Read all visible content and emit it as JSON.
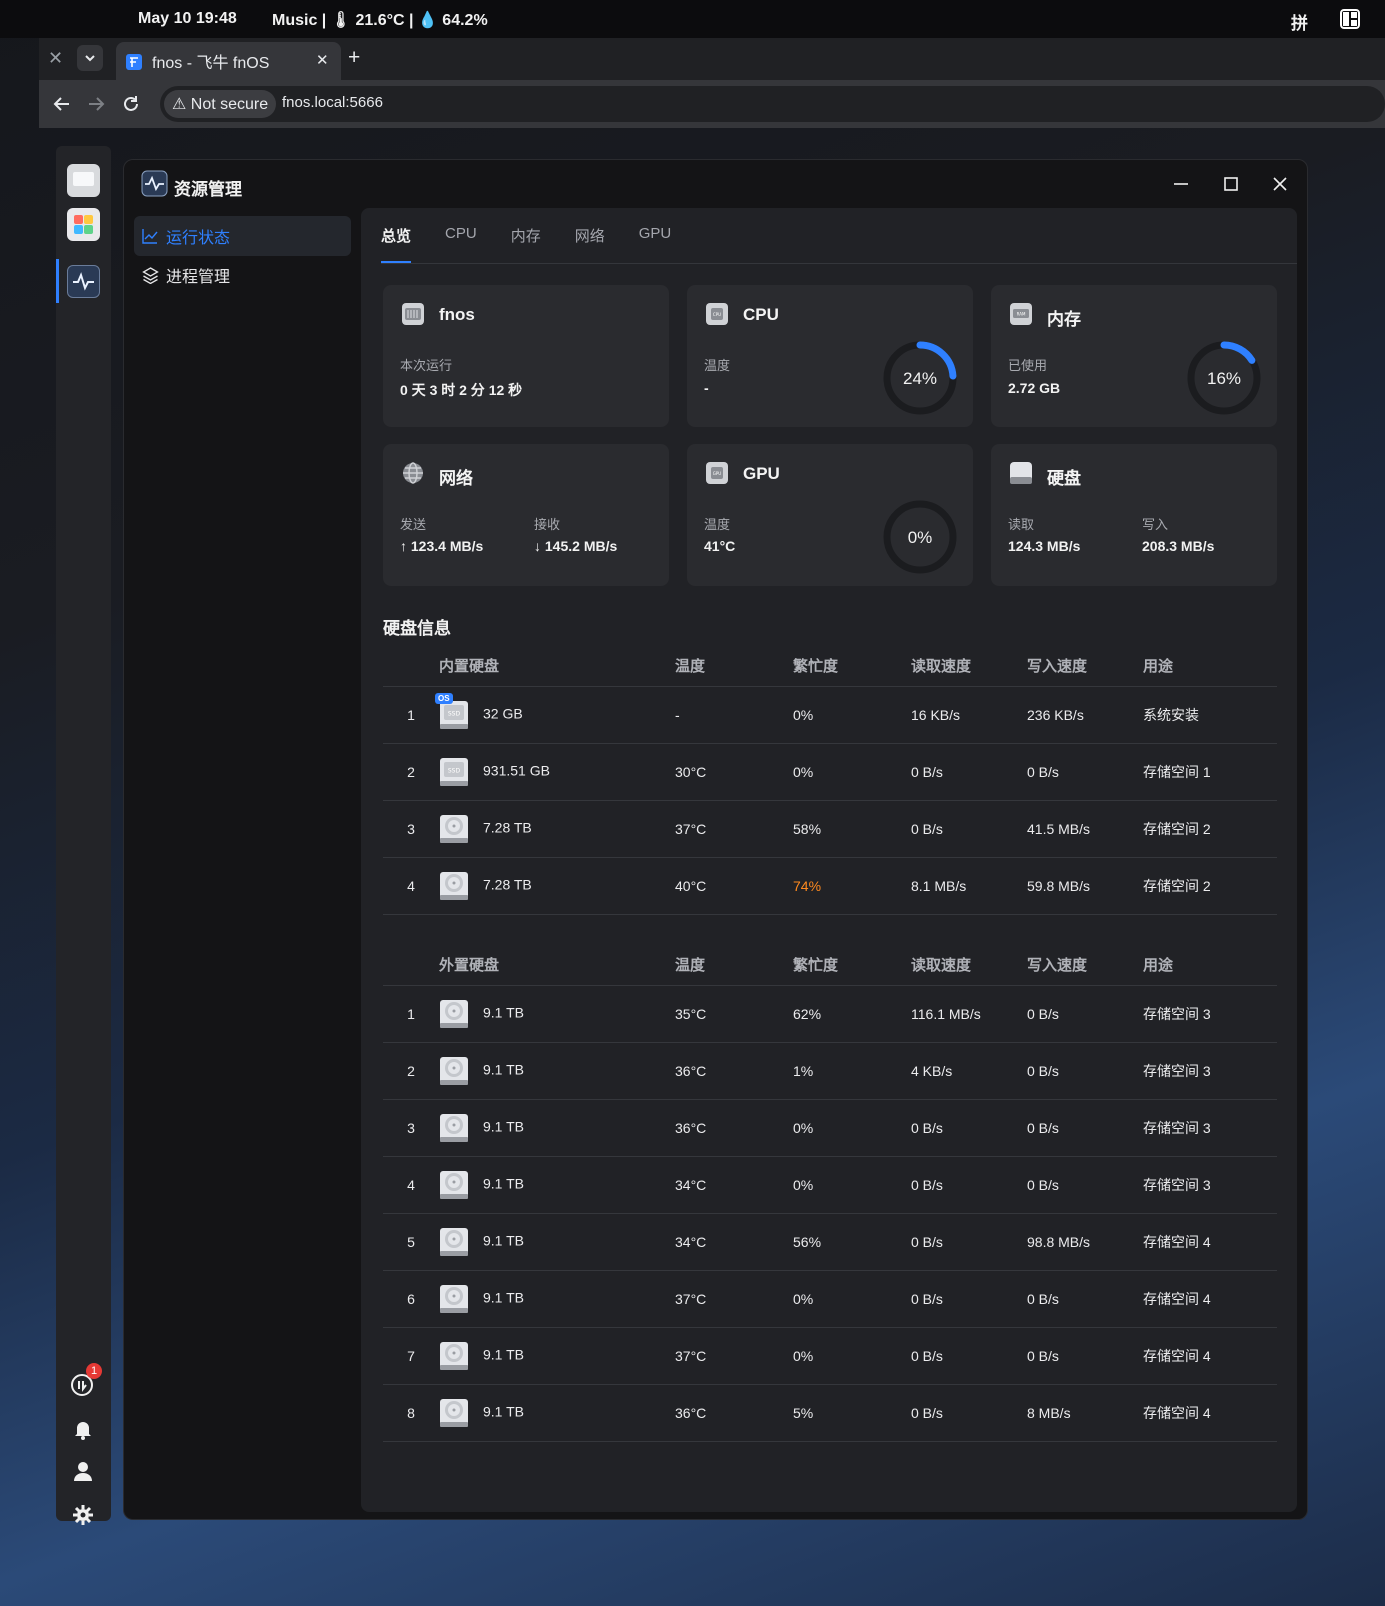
{
  "system_bar": {
    "datetime": "May 10  19:48",
    "music_status": "Music | 🌡 21.6°C | 💧 64.2%",
    "ime": "拼"
  },
  "browser": {
    "tab_title": "fnos - 飞牛 fnOS",
    "new_tab": "+",
    "security_label": "⚠ Not secure",
    "url": "fnos.local:5666"
  },
  "app": {
    "title": "资源管理",
    "sidebar": [
      {
        "label": "运行状态",
        "active": true
      },
      {
        "label": "进程管理",
        "active": false
      }
    ],
    "tabs": [
      "总览",
      "CPU",
      "内存",
      "网络",
      "GPU"
    ],
    "cards": {
      "system": {
        "title": "fnos",
        "uptime_label": "本次运行",
        "uptime_value": "0 天 3 时 2 分 12 秒"
      },
      "cpu": {
        "title": "CPU",
        "temp_label": "温度",
        "temp_value": "-",
        "usage_text": "24%",
        "usage": 0.24
      },
      "memory": {
        "title": "内存",
        "used_label": "已使用",
        "used_value": "2.72 GB",
        "usage_text": "16%",
        "usage": 0.16
      },
      "network": {
        "title": "网络",
        "send_label": "发送",
        "send_value": "↑ 123.4 MB/s",
        "recv_label": "接收",
        "recv_value": "↓ 145.2 MB/s"
      },
      "gpu": {
        "title": "GPU",
        "temp_label": "温度",
        "temp_value": "41°C",
        "usage_text": "0%",
        "usage": 0
      },
      "disk": {
        "title": "硬盘",
        "read_label": "读取",
        "read_value": "124.3 MB/s",
        "write_label": "写入",
        "write_value": "208.3 MB/s"
      }
    },
    "disk_section_title": "硬盘信息",
    "internal_headers": [
      "",
      "内置硬盘",
      "温度",
      "繁忙度",
      "读取速度",
      "写入速度",
      "用途"
    ],
    "external_headers": [
      "",
      "外置硬盘",
      "温度",
      "繁忙度",
      "读取速度",
      "写入速度",
      "用途"
    ],
    "internal_disks": [
      {
        "no": "1",
        "type": "ssd-os",
        "size": "32 GB",
        "temp": "-",
        "busy": "0%",
        "read": "16 KB/s",
        "write": "236 KB/s",
        "use": "系统安装"
      },
      {
        "no": "2",
        "type": "ssd",
        "size": "931.51 GB",
        "temp": "30°C",
        "busy": "0%",
        "read": "0 B/s",
        "write": "0 B/s",
        "use": "存储空间 1"
      },
      {
        "no": "3",
        "type": "hdd",
        "size": "7.28 TB",
        "temp": "37°C",
        "busy": "58%",
        "read": "0 B/s",
        "write": "41.5 MB/s",
        "use": "存储空间 2"
      },
      {
        "no": "4",
        "type": "hdd",
        "size": "7.28 TB",
        "temp": "40°C",
        "busy": "74%",
        "busy_warn": true,
        "read": "8.1 MB/s",
        "write": "59.8 MB/s",
        "use": "存储空间 2"
      }
    ],
    "external_disks": [
      {
        "no": "1",
        "type": "hdd",
        "size": "9.1 TB",
        "temp": "35°C",
        "busy": "62%",
        "read": "116.1 MB/s",
        "write": "0 B/s",
        "use": "存储空间 3"
      },
      {
        "no": "2",
        "type": "hdd",
        "size": "9.1 TB",
        "temp": "36°C",
        "busy": "1%",
        "read": "4 KB/s",
        "write": "0 B/s",
        "use": "存储空间 3"
      },
      {
        "no": "3",
        "type": "hdd",
        "size": "9.1 TB",
        "temp": "36°C",
        "busy": "0%",
        "read": "0 B/s",
        "write": "0 B/s",
        "use": "存储空间 3"
      },
      {
        "no": "4",
        "type": "hdd",
        "size": "9.1 TB",
        "temp": "34°C",
        "busy": "0%",
        "read": "0 B/s",
        "write": "0 B/s",
        "use": "存储空间 3"
      },
      {
        "no": "5",
        "type": "hdd",
        "size": "9.1 TB",
        "temp": "34°C",
        "busy": "56%",
        "read": "0 B/s",
        "write": "98.8 MB/s",
        "use": "存储空间 4"
      },
      {
        "no": "6",
        "type": "hdd",
        "size": "9.1 TB",
        "temp": "37°C",
        "busy": "0%",
        "read": "0 B/s",
        "write": "0 B/s",
        "use": "存储空间 4"
      },
      {
        "no": "7",
        "type": "hdd",
        "size": "9.1 TB",
        "temp": "37°C",
        "busy": "0%",
        "read": "0 B/s",
        "write": "0 B/s",
        "use": "存储空间 4"
      },
      {
        "no": "8",
        "type": "hdd",
        "size": "9.1 TB",
        "temp": "36°C",
        "busy": "5%",
        "read": "0 B/s",
        "write": "8 MB/s",
        "use": "存储空间 4"
      }
    ]
  },
  "dock": {
    "update_badge": "1"
  },
  "colors": {
    "accent": "#2f80ff",
    "warning": "#ff8a1e",
    "card_bg": "#2a2b2f",
    "panel_bg": "#212226"
  }
}
